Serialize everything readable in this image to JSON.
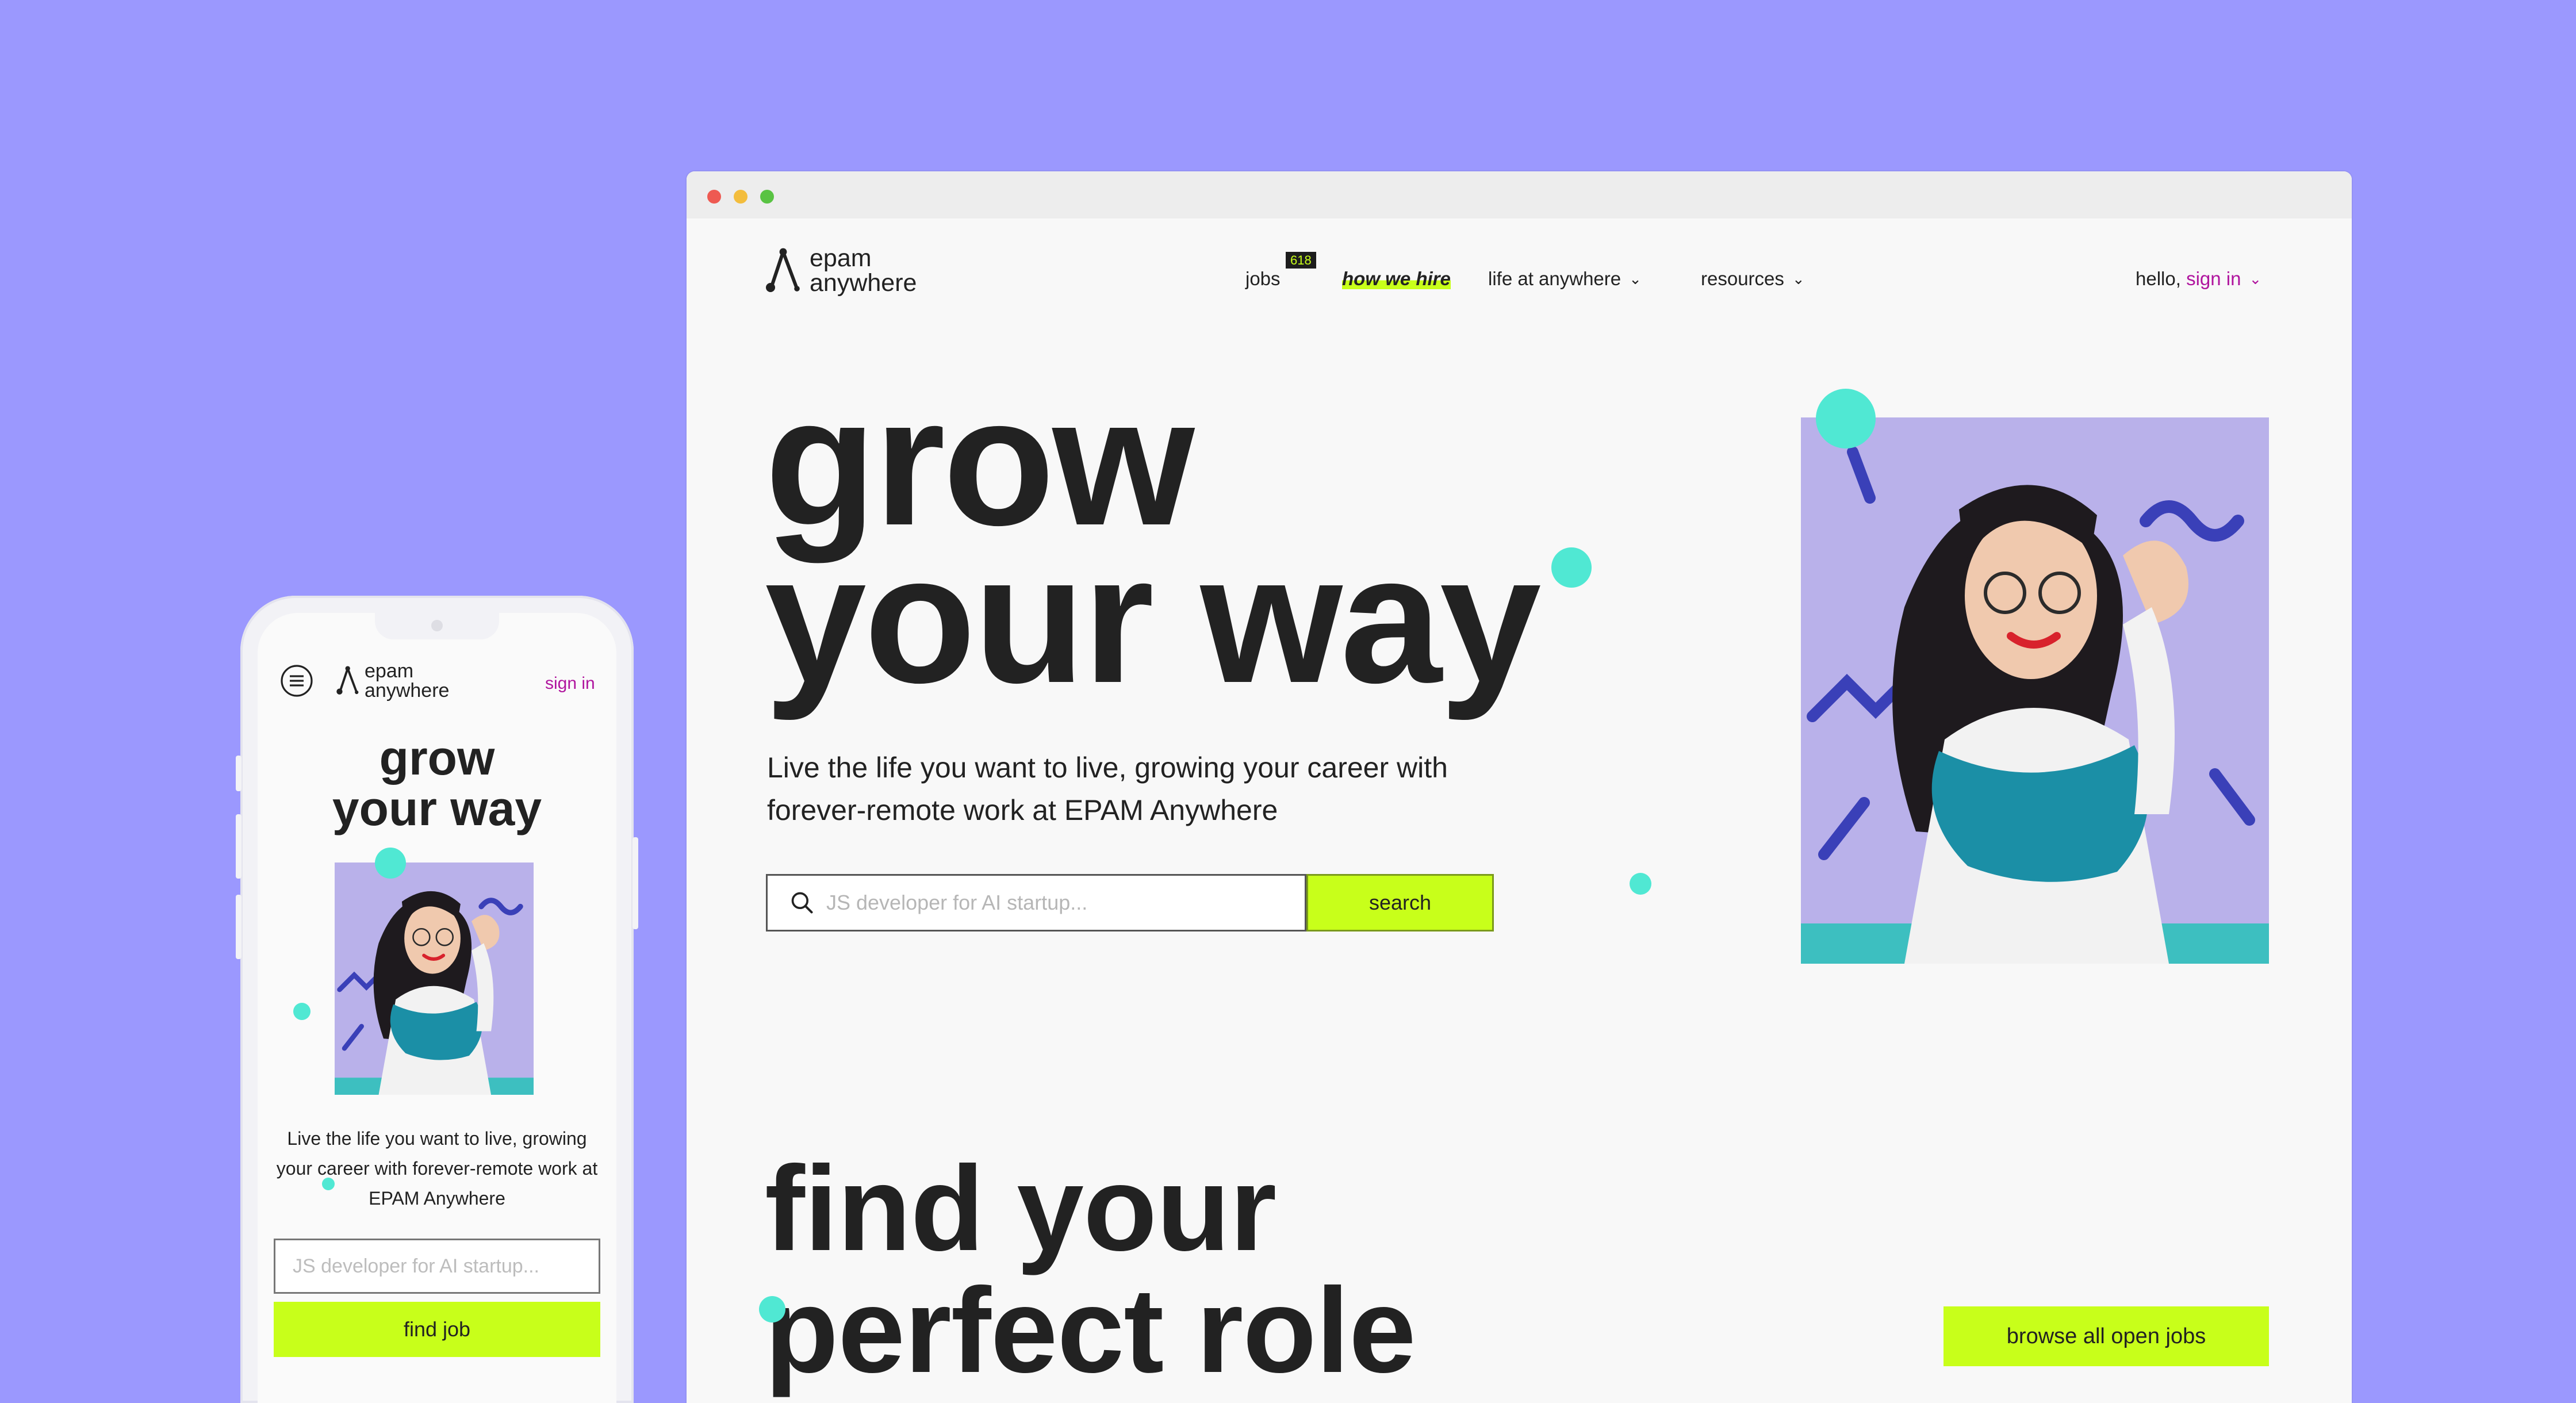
{
  "brand": {
    "logo_line1": "epam",
    "logo_line2": "anywhere",
    "accent_color": "#c8ff1a",
    "link_color": "#b0159e",
    "dot_color": "#50e8d3",
    "background_color": "#9b98fe"
  },
  "desktop": {
    "nav": {
      "jobs_label": "jobs",
      "jobs_count": "618",
      "how_we_hire_label": "how we hire",
      "life_label": "life at anywhere",
      "resources_label": "resources",
      "hello_label": "hello,",
      "signin_label": "sign in",
      "chevron_icon": "chevron-down-icon"
    },
    "hero": {
      "title_line1": "grow",
      "title_line2": "your way",
      "subtitle_line1": "Live the life you want to live, growing your career with",
      "subtitle_line2": "forever-remote work at EPAM Anywhere",
      "search_placeholder": "JS developer for AI startup...",
      "search_button": "search",
      "search_icon": "search-icon"
    },
    "find": {
      "title_line1": "find your",
      "title_line2": "perfect role",
      "browse_button": "browse all open jobs"
    }
  },
  "mobile": {
    "menu_icon": "hamburger-menu-icon",
    "signin_label": "sign in",
    "title_line1": "grow",
    "title_line2": "your way",
    "subtitle": "Live the life you want to live, growing your career with forever-remote work at EPAM Anywhere",
    "search_placeholder": "JS developer for AI startup...",
    "find_job_button": "find job"
  }
}
